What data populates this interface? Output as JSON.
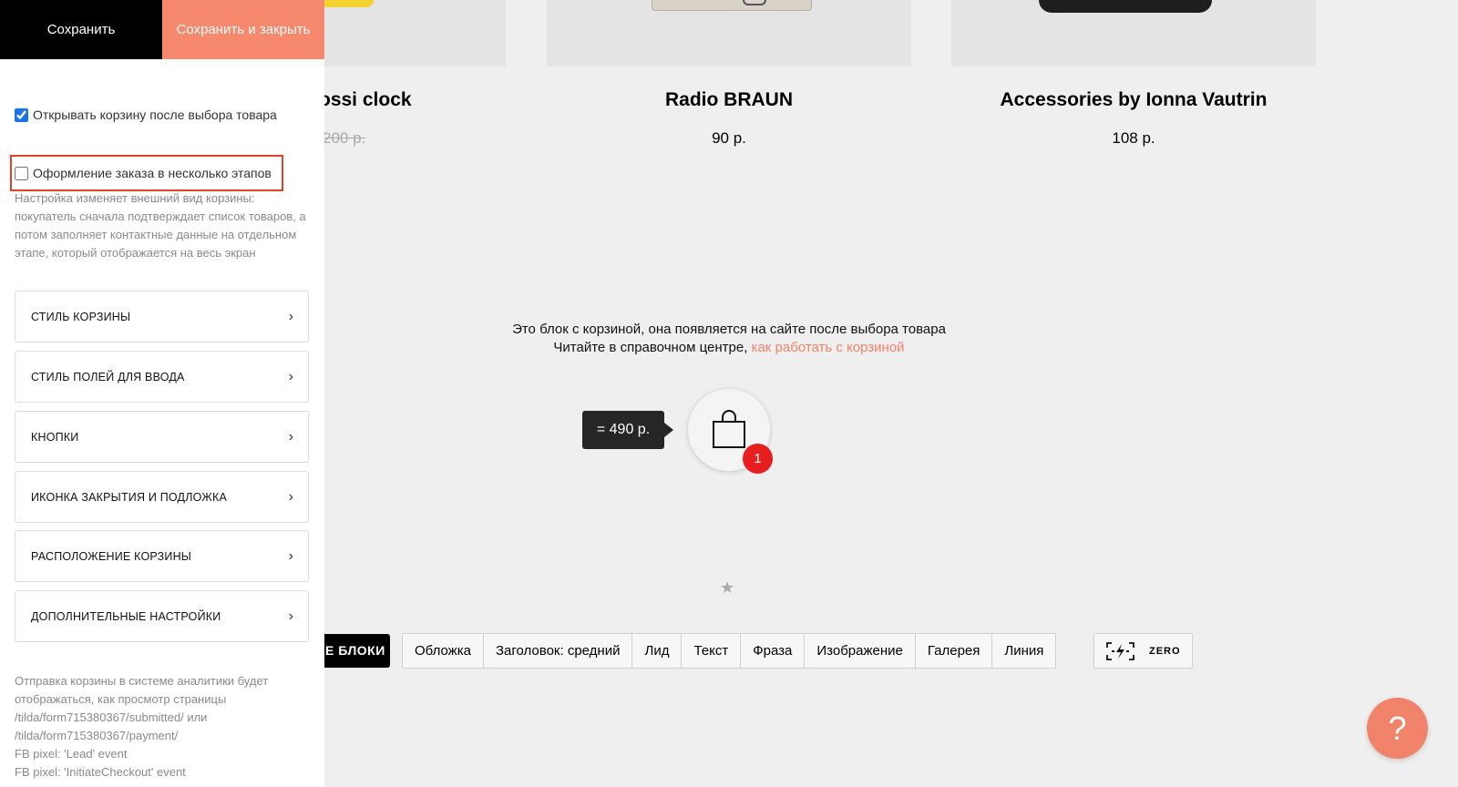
{
  "header": {
    "save_label": "Сохранить",
    "save_close_label": "Сохранить и закрыть"
  },
  "settings": {
    "open_cart_checkbox": {
      "label": "Открывать корзину после выбора товара",
      "checked": true
    },
    "multistep_checkbox": {
      "label": "Оформление заказа в несколько этапов",
      "checked": false
    },
    "multistep_hint": "Настройка изменяет внешний вид корзины: покупатель сначала подтверждает список товаров, а потом заполняет контактные данные на отдельном этапе, который отображается на весь экран",
    "sections": [
      {
        "label": "Стиль корзины"
      },
      {
        "label": "Стиль полей для ввода"
      },
      {
        "label": "Кнопки"
      },
      {
        "label": "Иконка закрытия и подложка"
      },
      {
        "label": "Расположение корзины"
      },
      {
        "label": "Дополнительные настройки"
      }
    ],
    "analytics_lines": [
      "Отправка корзины в системе аналитики будет",
      "отображаться, как просмотр страницы",
      "/tilda/form715380367/submitted/ или",
      "/tilda/form715380367/payment/",
      "FB pixel: 'Lead' event",
      "FB pixel: 'InitiateCheckout' event"
    ]
  },
  "products": [
    {
      "title": "ossi clock",
      "price": "200 р.",
      "strikethrough": true
    },
    {
      "title": "Radio BRAUN",
      "price": "90 р."
    },
    {
      "title": "Accessories by Ionna Vautrin",
      "price": "108 р."
    }
  ],
  "cart_block": {
    "info_line1": "Это блок с корзиной, она появляется на сайте после выбора товара",
    "info_line2": "Читайте в справочном центре,",
    "info_link": "как работать с корзиной",
    "total": "= 490 р.",
    "badge_count": "1"
  },
  "block_toolbar": {
    "all_blocks_label": "Е БЛОКИ",
    "buttons": [
      "Обложка",
      "Заголовок: средний",
      "Лид",
      "Текст",
      "Фраза",
      "Изображение",
      "Галерея",
      "Линия"
    ],
    "zero_label": "ZERO"
  },
  "help": {
    "label": "?"
  },
  "colors": {
    "accent": "#f5886d",
    "badge": "#e71e1e",
    "highlight": "#e2402a",
    "checkbox": "#1a73e8"
  }
}
